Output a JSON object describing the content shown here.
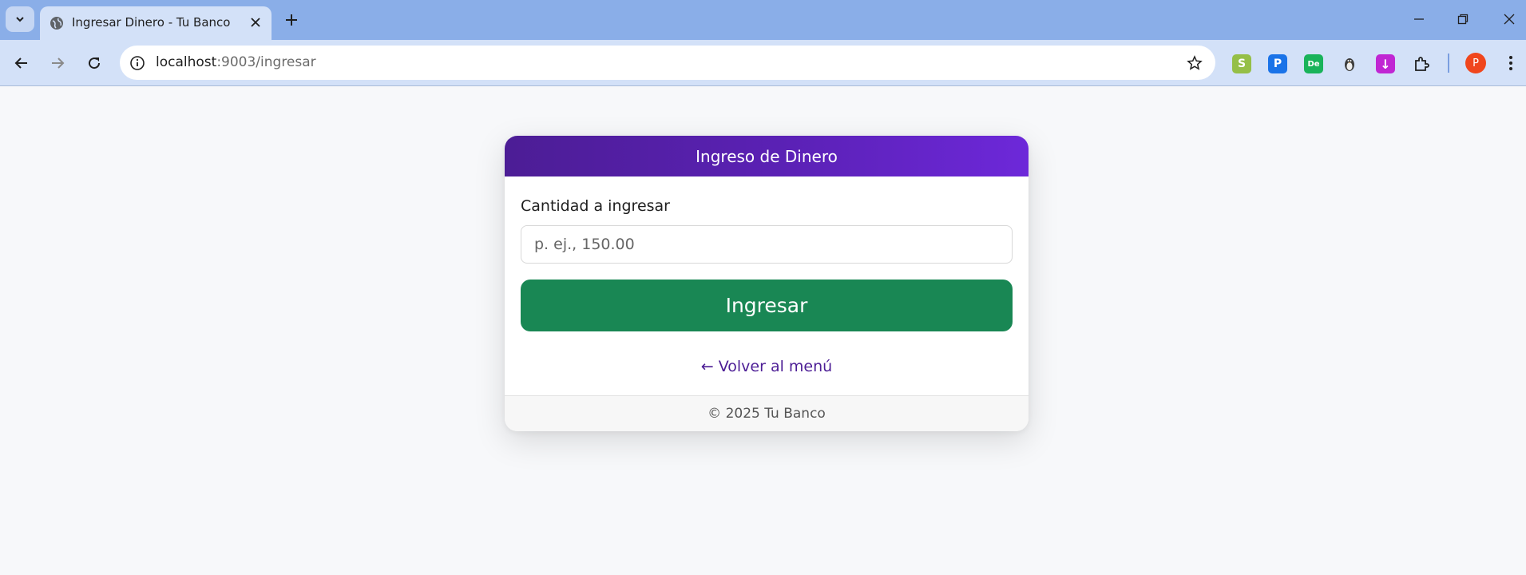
{
  "browser": {
    "tab": {
      "title": "Ingresar Dinero - Tu Banco"
    },
    "address_bar": {
      "host": "localhost",
      "rest": ":9003/ingresar"
    },
    "profile_initial": "P",
    "extensions": [
      {
        "icon": "shopify-extension-icon",
        "glyph": "S",
        "color": "#95bf47"
      },
      {
        "icon": "pushbullet-extension-icon",
        "glyph": "P",
        "color": "#1a73e8"
      },
      {
        "icon": "de-extension-icon",
        "glyph": "De",
        "color": "#19b35a"
      },
      {
        "icon": "penguin-extension-icon",
        "glyph": "",
        "color": "#d3e1f8"
      },
      {
        "icon": "download-extension-icon",
        "glyph": "↓",
        "color": "#c026d3"
      }
    ]
  },
  "card": {
    "title": "Ingreso de Dinero",
    "amount_label": "Cantidad a ingresar",
    "amount_placeholder": "p. ej., 150.00",
    "amount_value": "",
    "submit_label": "Ingresar",
    "back_link": "← Volver al menú",
    "footer": "© 2025 Tu Banco"
  },
  "colors": {
    "header_gradient_start": "#4c1d95",
    "header_gradient_end": "#6d28d9",
    "submit_button": "#198754",
    "link": "#4c1d95",
    "page_background": "#f7f8fa"
  }
}
